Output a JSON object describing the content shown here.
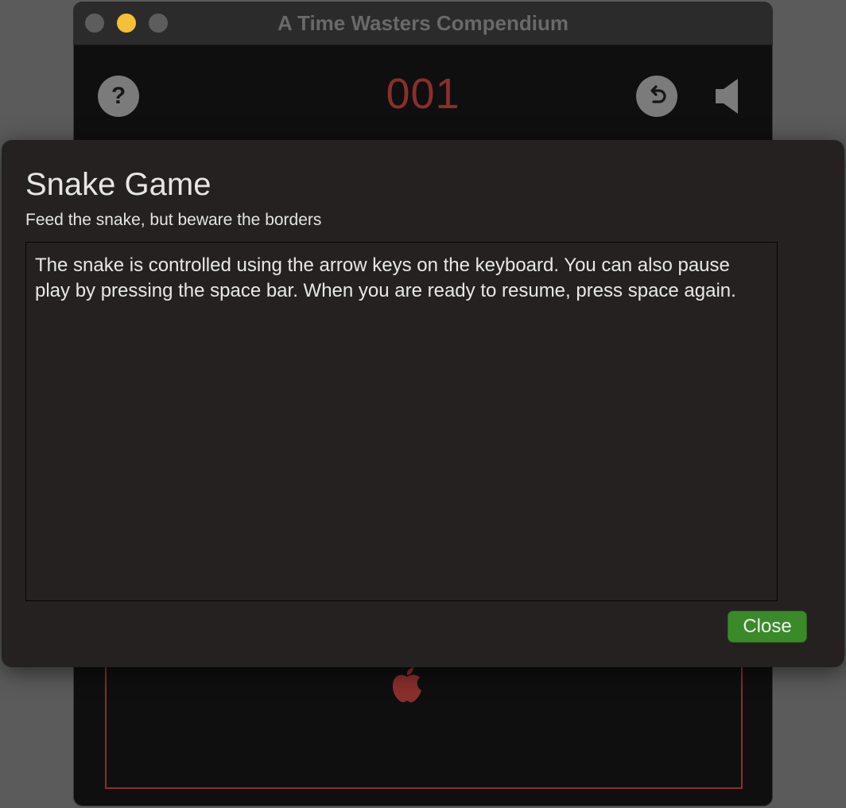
{
  "window": {
    "title": "A Time Wasters Compendium"
  },
  "toolbar": {
    "help_label": "?",
    "score": "001",
    "score_color": "#8a2f2c"
  },
  "dialog": {
    "title": "Snake Game",
    "subtitle": "Feed the snake, but beware the borders",
    "body": "The snake is controlled using the arrow keys on the keyboard. You can also pause play by pressing the space bar. When you are ready to resume, press space again.",
    "close_label": "Close",
    "close_color": "#3a8a2a"
  },
  "icons": {
    "help": "question-mark-icon",
    "undo": "undo-arrow-icon",
    "sound": "speaker-icon",
    "food": "apple-icon"
  }
}
